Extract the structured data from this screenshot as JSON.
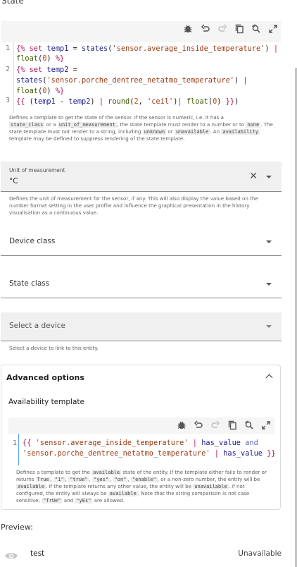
{
  "state_label": "State",
  "state_template": {
    "line_numbers": [
      "1",
      "2",
      "3"
    ],
    "help_parts": {
      "p1": "Defines a template to get the state of the sensor. If the sensor is numeric, i.e. it has a",
      "c1": "state_class",
      "p2": " or a ",
      "c2": "unit_of_measurement",
      "p3": ", the state template must render to a number or to ",
      "c3": "none",
      "p4": ". The state template must not render to a string, including ",
      "c4": "unknown",
      "p5": " or ",
      "c5": "unavailable",
      "p6": ". An ",
      "c6": "availability",
      "p7": " template may be defined to suppress rendering of the state template."
    }
  },
  "unit_field": {
    "label": "Unit of measurement",
    "value": "°C",
    "help": "Defines the unit of measurement for the sensor, if any. This will also display the value based on the number format setting in the user profile and influence the graphical presentation in the history visualisation as a continuous value."
  },
  "device_class_field": {
    "label": "Device class"
  },
  "state_class_field": {
    "label": "State class"
  },
  "device_field": {
    "label": "Select a device",
    "help": "Select a device to link to this entity."
  },
  "advanced": {
    "title": "Advanced options",
    "availability_title": "Availability template",
    "line_numbers": [
      "1"
    ],
    "help_parts": {
      "p1": "Defines a template to get the ",
      "c1": "available",
      "p2": " state of the entity. If the template either fails to render or returns ",
      "c2": "True",
      "p3": ", ",
      "c3": "\"1\"",
      "p4": ", ",
      "c4": "\"true\"",
      "p5": ", ",
      "c5": "\"yes\"",
      "p6": ", ",
      "c6": "\"on\"",
      "p7": ", ",
      "c7": "\"enable\"",
      "p8": ", or a non-zero number, the entity will be ",
      "c8": "available",
      "p9": ". If the template returns any other value, the entity will be ",
      "c9": "unavailable",
      "p10": ". If not configured, the entity will always be ",
      "c10": "available",
      "p11": ". Note that the string comparison is not case sensitive; ",
      "c11": "\"TrUe\"",
      "p12": " and ",
      "c12": "\"yEs\"",
      "p13": " are allowed."
    }
  },
  "preview": {
    "label": "Preview:",
    "entity_name": "test",
    "entity_state": "Unavailable"
  },
  "icons": {
    "toolbar": [
      "bug-icon",
      "undo-icon",
      "redo-icon",
      "copy-icon",
      "search-replace-icon",
      "fullscreen-icon"
    ],
    "entity": "eye-icon"
  }
}
